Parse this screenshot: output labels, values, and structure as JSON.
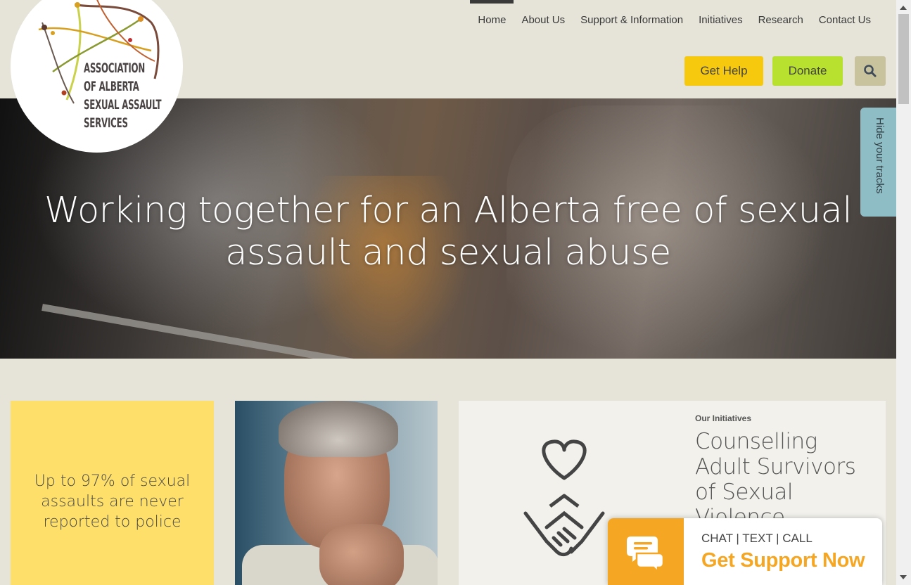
{
  "logo": {
    "text": "ASSOCIATION\nOF ALBERTA\nSEXUAL ASSAULT\nSERVICES"
  },
  "nav": {
    "items": [
      {
        "label": "Home",
        "active": true
      },
      {
        "label": "About Us"
      },
      {
        "label": "Support & Information"
      },
      {
        "label": "Initiatives"
      },
      {
        "label": "Research"
      },
      {
        "label": "Contact Us"
      }
    ]
  },
  "actions": {
    "get_help": "Get Help",
    "donate": "Donate",
    "search_icon": "search-icon"
  },
  "colors": {
    "background": "#e6e4d8",
    "get_help": "#f6c90e",
    "donate": "#b8e02e",
    "search": "#c8c39d",
    "hide_tab": "#8fbdc6",
    "stat_card": "#fedf6a",
    "chat_accent": "#f5a623"
  },
  "hero": {
    "title": "Working together for an Alberta free of sexual assault and sexual abuse"
  },
  "hide_tracks": "Hide your tracks",
  "stat_card": {
    "text": "Up to 97% of sexual assaults are never reported to police"
  },
  "initiative": {
    "kicker": "Our Initiatives",
    "title": "Counselling Adult Survivors of Sexual Violence",
    "icon": "heart-handshake-icon"
  },
  "chat": {
    "line1": "CHAT | TEXT | CALL",
    "line2": "Get Support Now",
    "icon": "chat-bubbles-icon"
  }
}
